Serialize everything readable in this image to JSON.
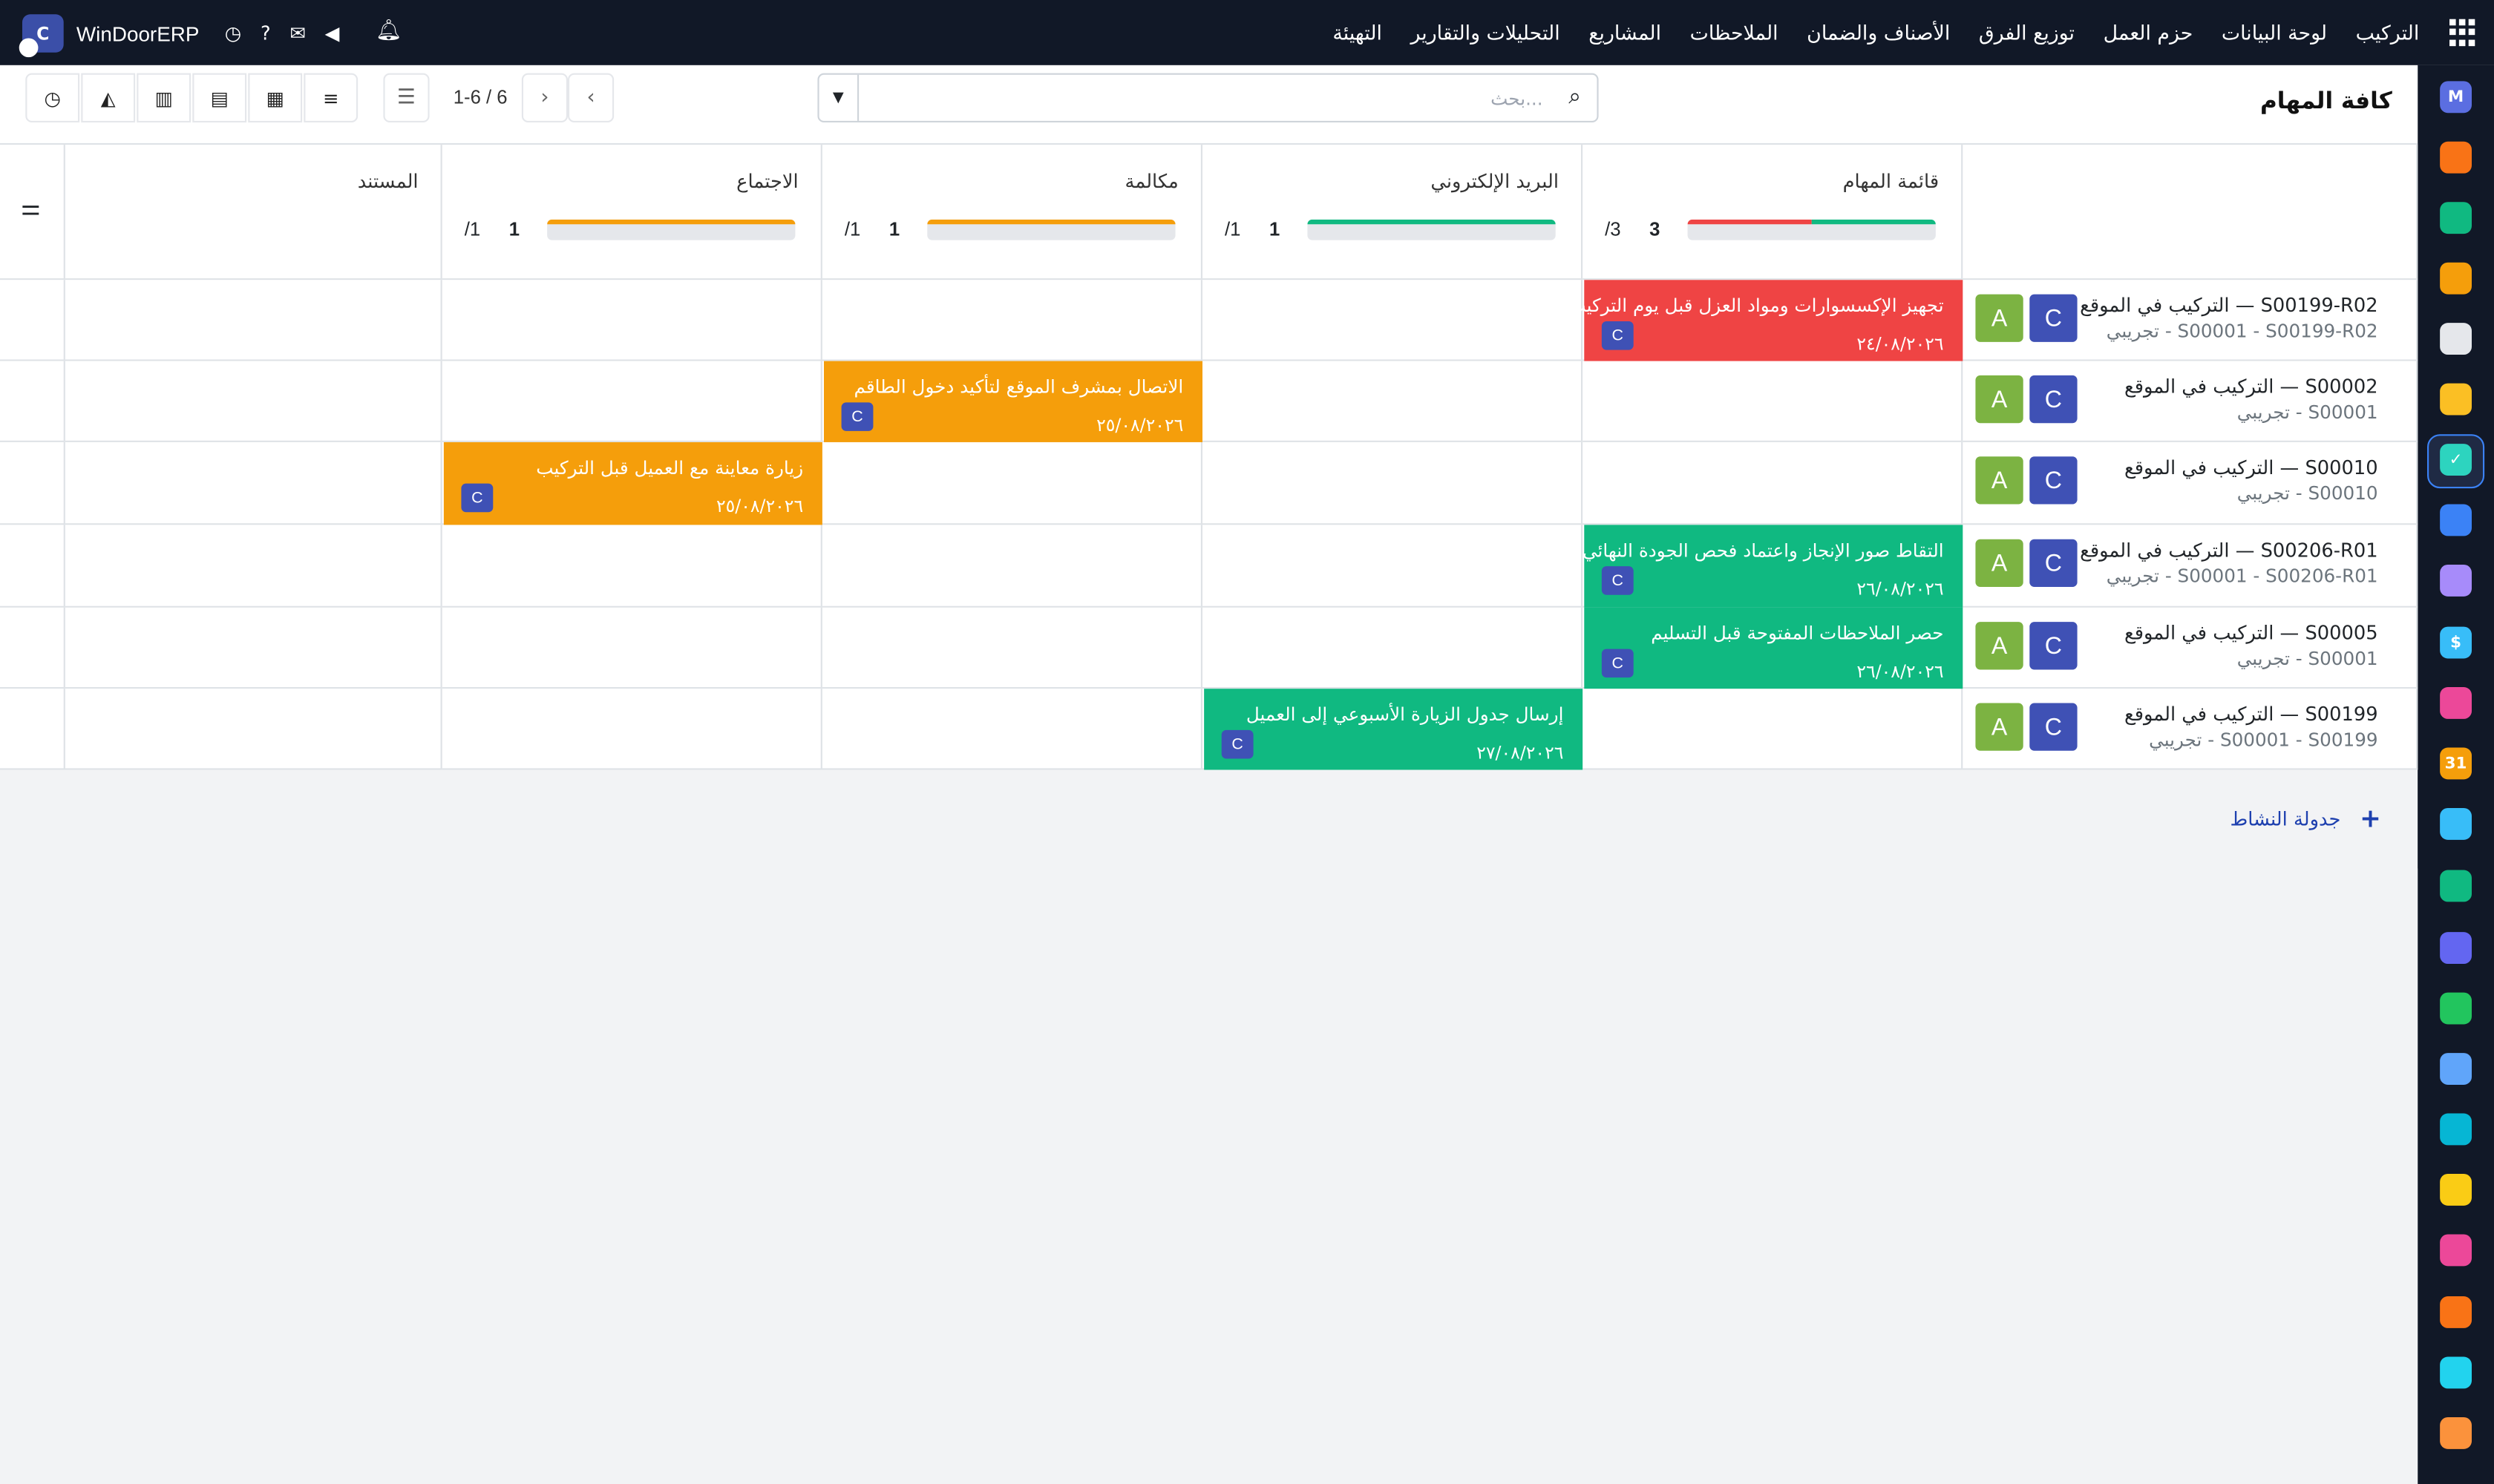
{
  "colors": {
    "topbar": "#111827",
    "red": "#ef4444",
    "orange": "#f59e0b",
    "green": "#10b981",
    "avatar_a": "#7cb342",
    "avatar_c": "#3f51b5",
    "link": "#1e40af"
  },
  "navbar": {
    "brand_initial": "C",
    "brand": "WinDoorERP",
    "menu": [
      "التركيب",
      "لوحة البيانات",
      "حزم العمل",
      "توزيع الفرق",
      "الأصناف والضمان",
      "الملاحظات",
      "المشاريع",
      "التحليلات والتقارير",
      "التهيئة"
    ],
    "icons": [
      "apps-icon",
      "clock-icon",
      "help-icon",
      "chat-icon",
      "megaphone-icon",
      "bell-icon"
    ]
  },
  "control_panel": {
    "title": "كافة المهام",
    "search_placeholder": "بحث...",
    "pager": "1-6 / 6",
    "views": [
      "list-view",
      "kanban-view",
      "calendar-view",
      "pivot-view",
      "graph-view",
      "activity-view"
    ]
  },
  "columns": [
    {
      "label": "قائمة المهام",
      "count": "3",
      "total": "/3",
      "progress": [
        {
          "color": "#10b981",
          "ratio": 0.5
        },
        {
          "color": "#ef4444",
          "ratio": 0.5
        }
      ]
    },
    {
      "label": "البريد الإلكتروني",
      "count": "1",
      "total": "/1",
      "progress": [
        {
          "color": "#10b981",
          "ratio": 1
        }
      ]
    },
    {
      "label": "مكالمة",
      "count": "1",
      "total": "/1",
      "progress": [
        {
          "color": "#f59e0b",
          "ratio": 1
        }
      ]
    },
    {
      "label": "الاجتماع",
      "count": "1",
      "total": "/1",
      "progress": [
        {
          "color": "#f59e0b",
          "ratio": 1
        }
      ]
    },
    {
      "label": "المستند",
      "count": "",
      "total": "",
      "progress": []
    }
  ],
  "rows": [
    {
      "title": "التركيب في الموقع — S00199-R02",
      "sub": "تجريبي - S00001 - S00199-R02",
      "avatars": [
        "C",
        "A"
      ]
    },
    {
      "title": "التركيب في الموقع — S00002",
      "sub": "تجريبي - S00001",
      "avatars": [
        "C",
        "A"
      ]
    },
    {
      "title": "التركيب في الموقع — S00010",
      "sub": "تجريبي - S00010",
      "avatars": [
        "C",
        "A"
      ]
    },
    {
      "title": "التركيب في الموقع — S00206-R01",
      "sub": "تجريبي - S00001 - S00206-R01",
      "avatars": [
        "C",
        "A"
      ]
    },
    {
      "title": "التركيب في الموقع — S00005",
      "sub": "تجريبي - S00001",
      "avatars": [
        "C",
        "A"
      ]
    },
    {
      "title": "التركيب في الموقع — S00199",
      "sub": "تجريبي - S00001 - S00199",
      "avatars": [
        "C",
        "A"
      ]
    }
  ],
  "activities": [
    {
      "row": 0,
      "col": 0,
      "text": "تجهيز الإكسسوارات ومواد العزل قبل يوم التركيب",
      "date": "٢٤/٠٨/٢٠٢٦",
      "color": "#ef4444",
      "avatar": "C"
    },
    {
      "row": 1,
      "col": 2,
      "text": "الاتصال بمشرف الموقع لتأكيد دخول الطاقم",
      "date": "٢٥/٠٨/٢٠٢٦",
      "color": "#f59e0b",
      "avatar": "C"
    },
    {
      "row": 2,
      "col": 3,
      "text": "زيارة معاينة مع العميل قبل التركيب",
      "date": "٢٥/٠٨/٢٠٢٦",
      "color": "#f59e0b",
      "avatar": "C"
    },
    {
      "row": 3,
      "col": 0,
      "text": "التقاط صور الإنجاز واعتماد فحص الجودة النهائي",
      "date": "٢٦/٠٨/٢٠٢٦",
      "color": "#10b981",
      "avatar": "C"
    },
    {
      "row": 4,
      "col": 0,
      "text": "حصر الملاحظات المفتوحة قبل التسليم",
      "date": "٢٦/٠٨/٢٠٢٦",
      "color": "#10b981",
      "avatar": "C"
    },
    {
      "row": 5,
      "col": 1,
      "text": "إرسال جدول الزيارة الأسبوعي إلى العميل",
      "date": "٢٧/٠٨/٢٠٢٦",
      "color": "#10b981",
      "avatar": "C"
    }
  ],
  "footer": {
    "schedule_label": "جدولة النشاط"
  },
  "rail_apps": [
    {
      "name": "m-app-icon",
      "color": "#5b6ee1",
      "glyph": "M"
    },
    {
      "name": "chat-bubble-icon",
      "color": "#f97316",
      "glyph": ""
    },
    {
      "name": "shield-check-icon",
      "color": "#10b981",
      "glyph": ""
    },
    {
      "name": "bar-chart-icon",
      "color": "#f59e0b",
      "glyph": ""
    },
    {
      "name": "box-icon",
      "color": "#e5e7eb",
      "glyph": ""
    },
    {
      "name": "image-icon",
      "color": "#fbbf24",
      "glyph": ""
    },
    {
      "name": "check-icon",
      "color": "#2dd4bf",
      "glyph": "✓"
    },
    {
      "name": "book-icon",
      "color": "#3b82f6",
      "glyph": ""
    },
    {
      "name": "package-icon",
      "color": "#a78bfa",
      "glyph": ""
    },
    {
      "name": "dollar-icon",
      "color": "#38bdf8",
      "glyph": "$"
    },
    {
      "name": "team-icon",
      "color": "#ec4899",
      "glyph": ""
    },
    {
      "name": "calendar-31-icon",
      "color": "#f59e0b",
      "glyph": "31"
    },
    {
      "name": "pen-icon",
      "color": "#38bdf8",
      "glyph": ""
    },
    {
      "name": "contact-icon",
      "color": "#10b981",
      "glyph": ""
    },
    {
      "name": "dashboard-icon",
      "color": "#6366f1",
      "glyph": ""
    },
    {
      "name": "whatsapp-icon",
      "color": "#22c55e",
      "glyph": ""
    },
    {
      "name": "gauge-icon",
      "color": "#60a5fa",
      "glyph": ""
    },
    {
      "name": "wave-icon",
      "color": "#06b6d4",
      "glyph": ""
    },
    {
      "name": "send-icon",
      "color": "#facc15",
      "glyph": ""
    },
    {
      "name": "card-icon",
      "color": "#ec4899",
      "glyph": ""
    },
    {
      "name": "cube-icon",
      "color": "#f97316",
      "glyph": ""
    },
    {
      "name": "pie-icon",
      "color": "#22d3ee",
      "glyph": ""
    },
    {
      "name": "hexagon-icon",
      "color": "#fb923c",
      "glyph": ""
    }
  ]
}
